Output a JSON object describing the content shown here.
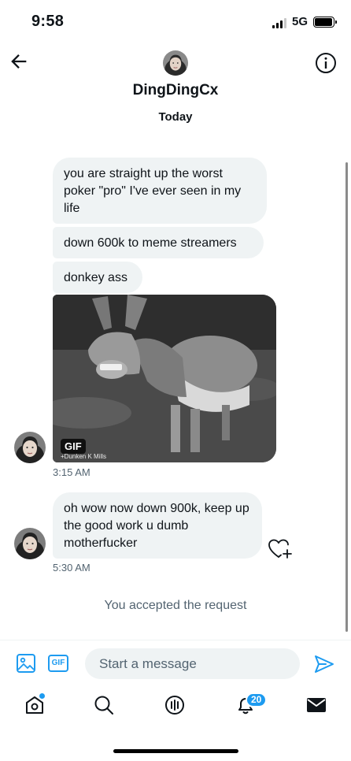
{
  "status_bar": {
    "time": "9:58",
    "network": "5G"
  },
  "header": {
    "name": "DingDingCx",
    "subtitle": "Today"
  },
  "messages": [
    {
      "text": "you are straight up the worst poker \"pro\" I've ever seen in my life"
    },
    {
      "text": "down 600k to meme streamers"
    },
    {
      "text": "donkey ass"
    }
  ],
  "gif": {
    "badge": "GIF",
    "caption": "+Dunken K Mills"
  },
  "timestamps": [
    "3:15 AM",
    "5:30 AM"
  ],
  "message_2": {
    "text": "oh wow now down 900k, keep up the good work u dumb motherfucker"
  },
  "system_message": "You accepted the request",
  "compose": {
    "placeholder": "Start a message",
    "gif_label": "GIF"
  },
  "nav": {
    "notification_count": "20"
  },
  "colors": {
    "accent": "#1d9bf0",
    "bubble": "#eff3f4",
    "secondary_text": "#536471"
  },
  "icons": [
    "back-arrow-icon",
    "info-icon",
    "heart-plus-icon",
    "image-icon",
    "gif-icon",
    "send-icon",
    "home-icon",
    "search-icon",
    "spaces-icon",
    "bell-icon",
    "mail-icon"
  ]
}
